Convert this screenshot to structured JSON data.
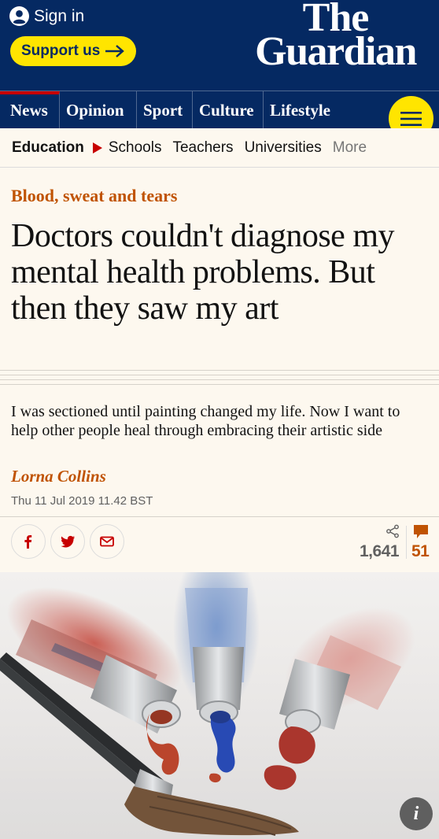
{
  "header": {
    "signin_label": "Sign in",
    "support_label": "Support us",
    "logo_line1": "The",
    "logo_line2": "Guardian"
  },
  "pillars": [
    "News",
    "Opinion",
    "Sport",
    "Culture",
    "Lifestyle"
  ],
  "subnav": {
    "section": "Education",
    "links": [
      "Schools",
      "Teachers",
      "Universities"
    ],
    "more": "More"
  },
  "article": {
    "kicker": "Blood, sweat and tears",
    "headline": "Doctors couldn't diagnose my mental health problems. But then they saw my art",
    "standfirst": "I was sectioned until painting changed my life. Now I want to help other people heal through embracing their artistic side",
    "byline": "Lorna Collins",
    "dateline": "Thu 11 Jul 2019 11.42 BST"
  },
  "share": {
    "share_count": "1,641",
    "comment_count": "51"
  },
  "image": {
    "info_label": "i"
  },
  "colors": {
    "brand_blue": "#052962",
    "support_yellow": "#ffe500",
    "kicker_orange": "#c05303",
    "news_red": "#c70000",
    "background": "#fdf8ef"
  },
  "icons": [
    "user-circle-icon",
    "arrow-right-icon",
    "menu-icon",
    "chevron-right-icon",
    "facebook-icon",
    "twitter-icon",
    "email-icon",
    "share-icon",
    "comment-icon",
    "info-icon"
  ]
}
